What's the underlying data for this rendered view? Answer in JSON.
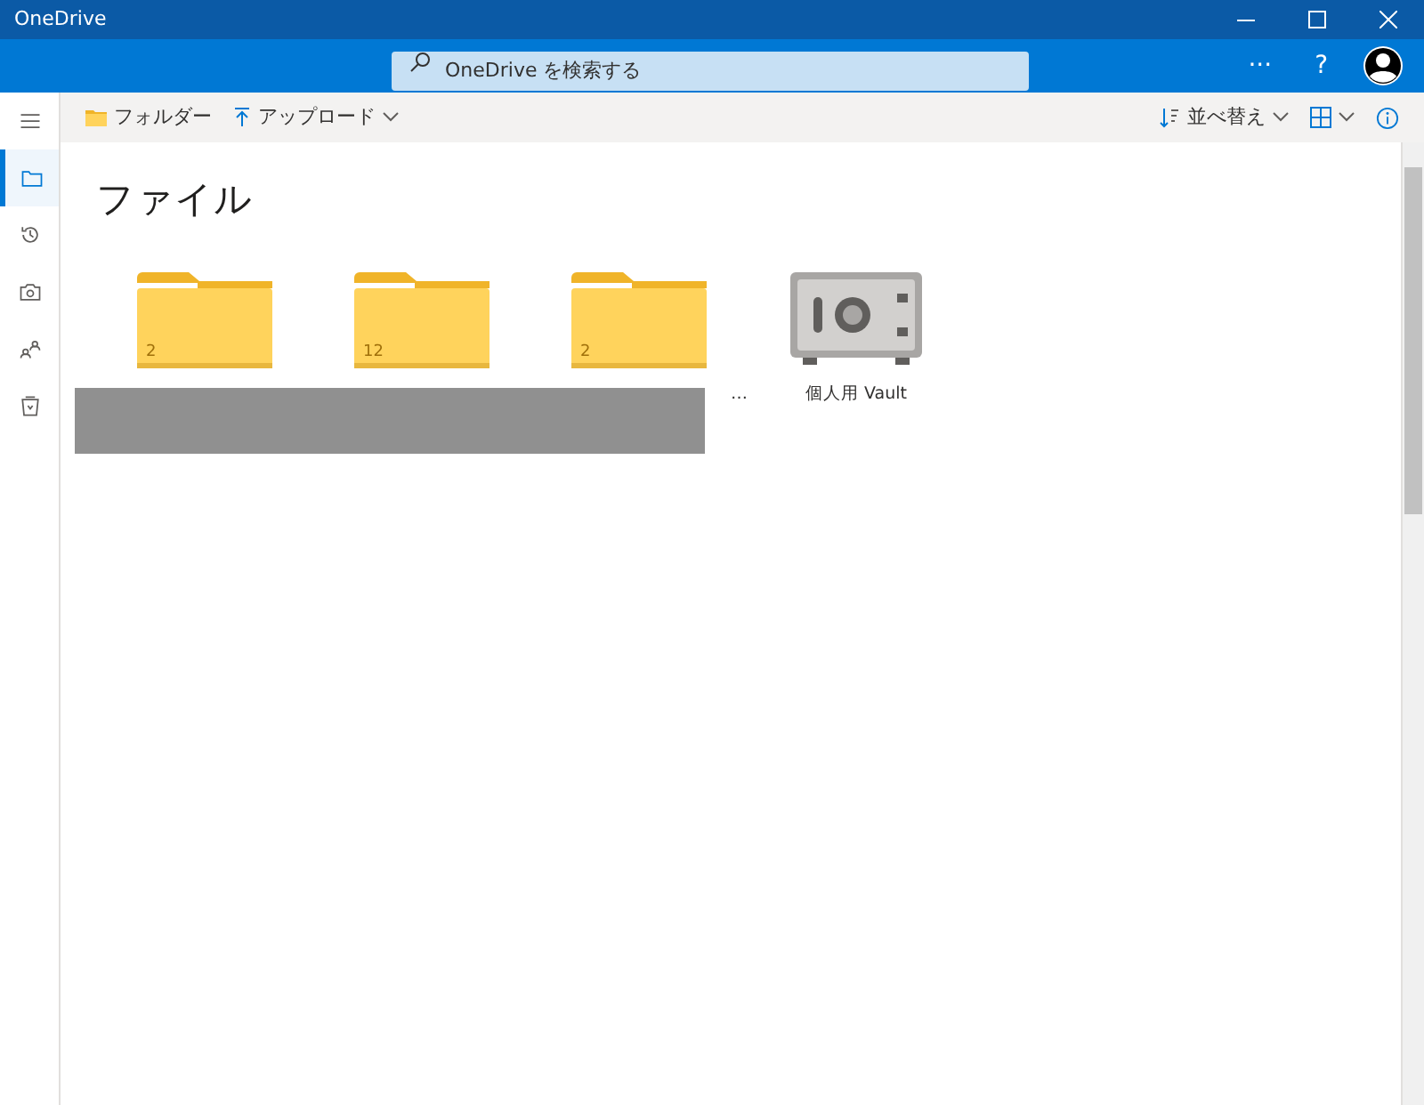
{
  "window": {
    "title": "OneDrive"
  },
  "search": {
    "placeholder": "OneDrive を検索する"
  },
  "header_actions": [
    {
      "kind": "more",
      "label": "···"
    },
    {
      "kind": "help",
      "label": "?"
    },
    {
      "kind": "avatar"
    }
  ],
  "sidebar": {
    "items": [
      {
        "kind": "menu",
        "selected": false
      },
      {
        "kind": "files",
        "selected": true
      },
      {
        "kind": "recent",
        "selected": false
      },
      {
        "kind": "photos",
        "selected": false
      },
      {
        "kind": "shared",
        "selected": false
      },
      {
        "kind": "recycle",
        "selected": false
      }
    ]
  },
  "toolbar": {
    "left": [
      {
        "kind": "folder",
        "label": "フォルダー",
        "caret": false
      },
      {
        "kind": "upload",
        "label": "アップロード",
        "caret": true
      }
    ],
    "right": [
      {
        "kind": "sort",
        "label": "並べ替え",
        "caret": true
      },
      {
        "kind": "view",
        "caret": true
      },
      {
        "kind": "info"
      }
    ]
  },
  "page_title": "ファイル",
  "items": [
    {
      "kind": "folder",
      "count": "2"
    },
    {
      "kind": "folder",
      "count": "12"
    },
    {
      "kind": "folder",
      "count": "2",
      "name": "…"
    },
    {
      "kind": "vault",
      "name": "個人用 Vault"
    }
  ]
}
